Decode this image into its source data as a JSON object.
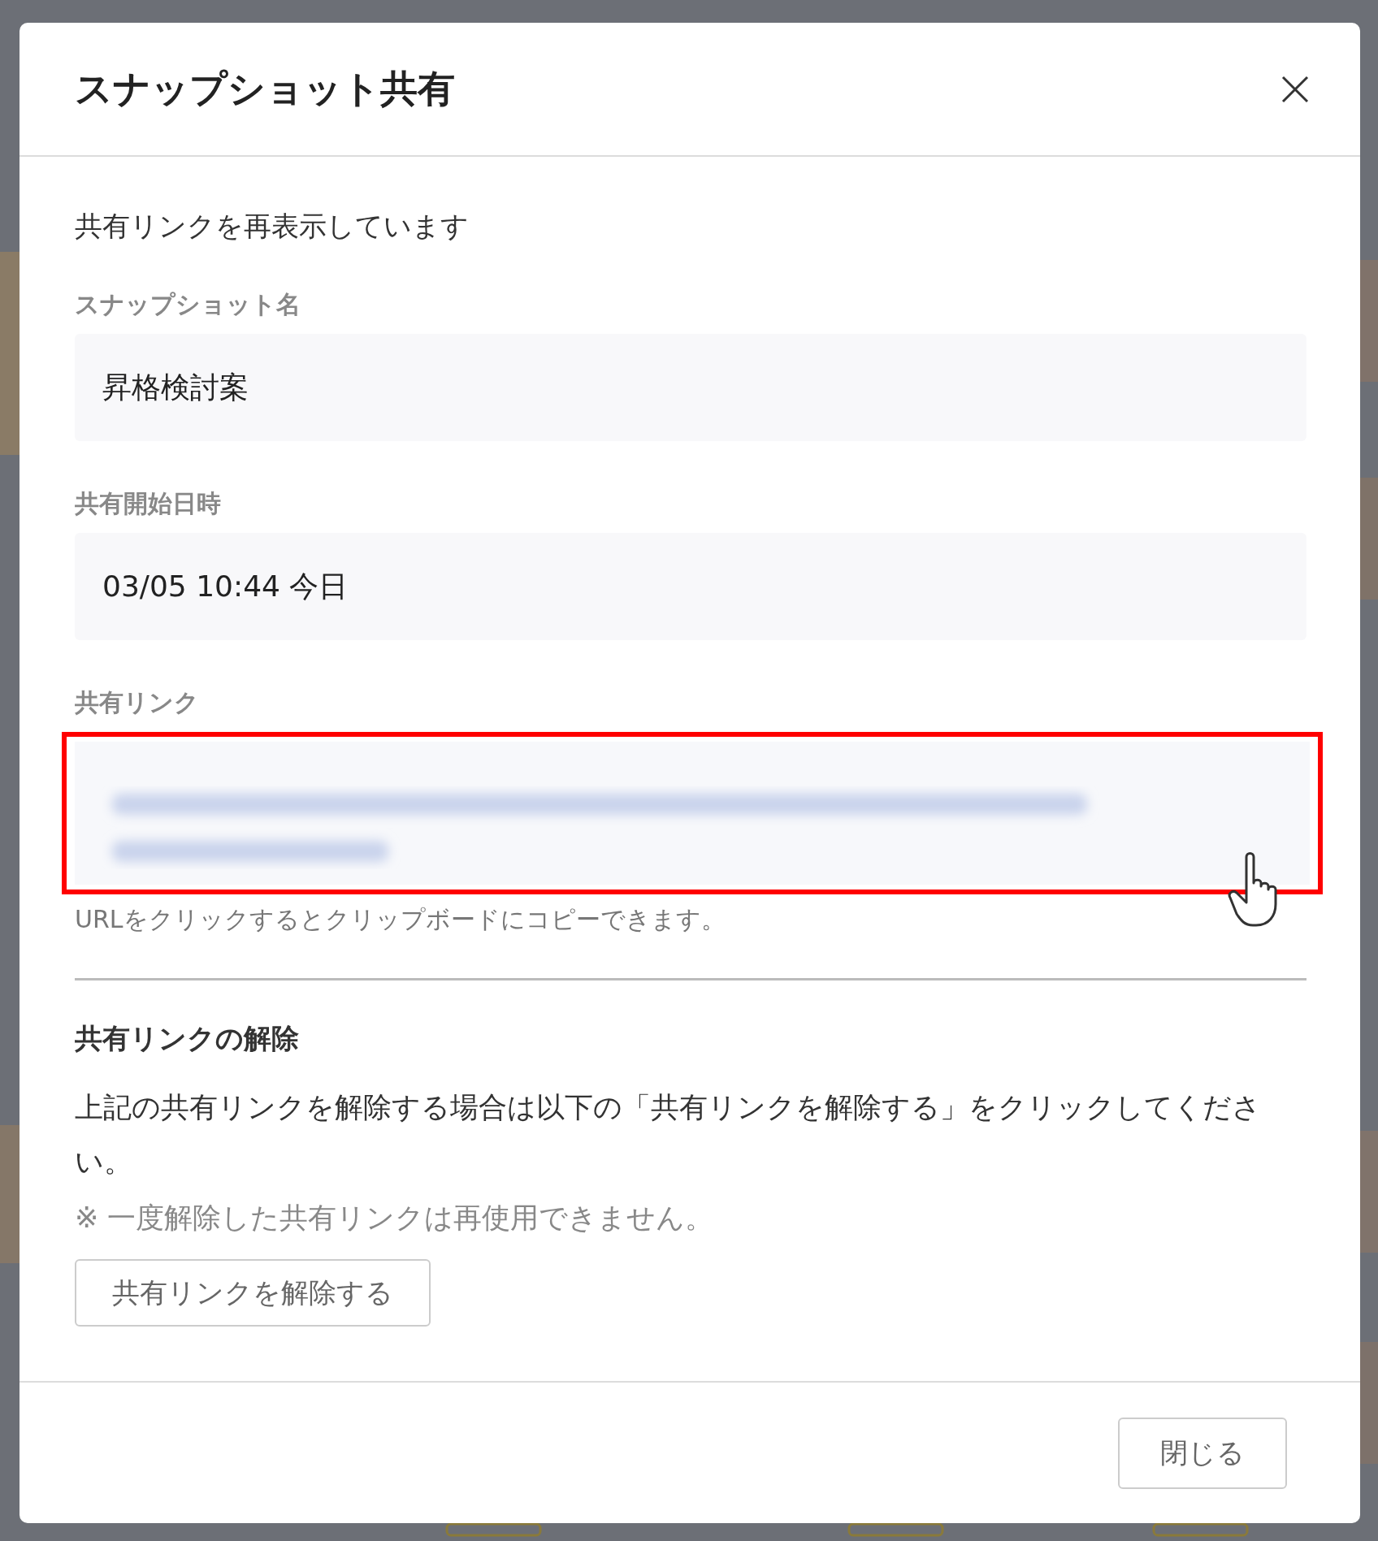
{
  "dialog": {
    "title": "スナップショット共有",
    "message": "共有リンクを再表示しています",
    "fields": [
      {
        "label": "スナップショット名",
        "value": "昇格検討案"
      },
      {
        "label": "共有開始日時",
        "value": "03/05 10:44 今日"
      }
    ],
    "link": {
      "label": "共有リンク",
      "highlighted": true,
      "hint": "URLをクリックするとクリップボードにコピーできます。"
    },
    "revoke": {
      "title": "共有リンクの解除",
      "text": "上記の共有リンクを解除する場合は以下の「共有リンクを解除する」をクリックしてください。",
      "note": "※ 一度解除した共有リンクは再使用できません。",
      "button": "共有リンクを解除する"
    },
    "footer": {
      "close_button": "閉じる"
    }
  }
}
